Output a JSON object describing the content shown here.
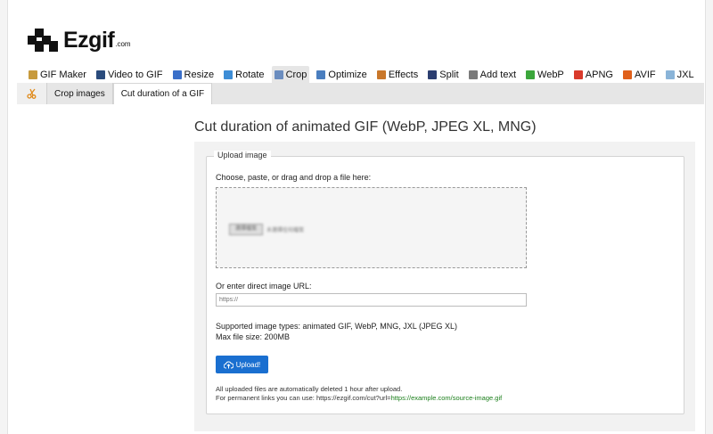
{
  "logo": {
    "name": "Ezgif",
    "suffix": ".com"
  },
  "nav": [
    {
      "label": "GIF Maker",
      "icon": "gif-maker-icon",
      "color": "#c79a3c"
    },
    {
      "label": "Video to GIF",
      "icon": "video-icon",
      "color": "#2a4b7c"
    },
    {
      "label": "Resize",
      "icon": "resize-icon",
      "color": "#3a6fc9"
    },
    {
      "label": "Rotate",
      "icon": "rotate-icon",
      "color": "#3d8dd6"
    },
    {
      "label": "Crop",
      "icon": "crop-icon",
      "color": "#6b8dbf",
      "active": true
    },
    {
      "label": "Optimize",
      "icon": "optimize-icon",
      "color": "#4a7ebf"
    },
    {
      "label": "Effects",
      "icon": "effects-icon",
      "color": "#c9772a"
    },
    {
      "label": "Split",
      "icon": "split-icon",
      "color": "#2c3e70"
    },
    {
      "label": "Add text",
      "icon": "add-text-icon",
      "color": "#7a7a7a"
    },
    {
      "label": "WebP",
      "icon": "webp-icon",
      "color": "#3ba63b"
    },
    {
      "label": "APNG",
      "icon": "apng-icon",
      "color": "#d93a2b"
    },
    {
      "label": "AVIF",
      "icon": "avif-icon",
      "color": "#e0601a"
    },
    {
      "label": "JXL",
      "icon": "jxl-icon",
      "color": "#8ab4d8"
    }
  ],
  "subnav": {
    "icon": "scissors-icon",
    "items": [
      "Crop images",
      "Cut duration of a GIF"
    ]
  },
  "main": {
    "title": "Cut duration of animated GIF (WebP, JPEG XL, MNG)",
    "legend": "Upload image",
    "choose_label": "Choose, paste, or drag and drop a file here:",
    "file_button": "選擇檔案",
    "file_status": "未選擇任何檔案",
    "url_label": "Or enter direct image URL:",
    "url_placeholder": "https://",
    "supported": "Supported image types: animated GIF, WebP, MNG, JXL (JPEG XL)",
    "max_size": "Max file size: 200MB",
    "upload_label": "Upload!",
    "note1": "All uploaded files are automatically deleted 1 hour after upload.",
    "note2_prefix": "For permanent links you can use: https://ezgif.com/cut?url=",
    "note2_link": "https://example.com/source-image.gif"
  },
  "colors": {
    "accent": "#1a6fd0",
    "link_green": "#1b7f1b"
  }
}
